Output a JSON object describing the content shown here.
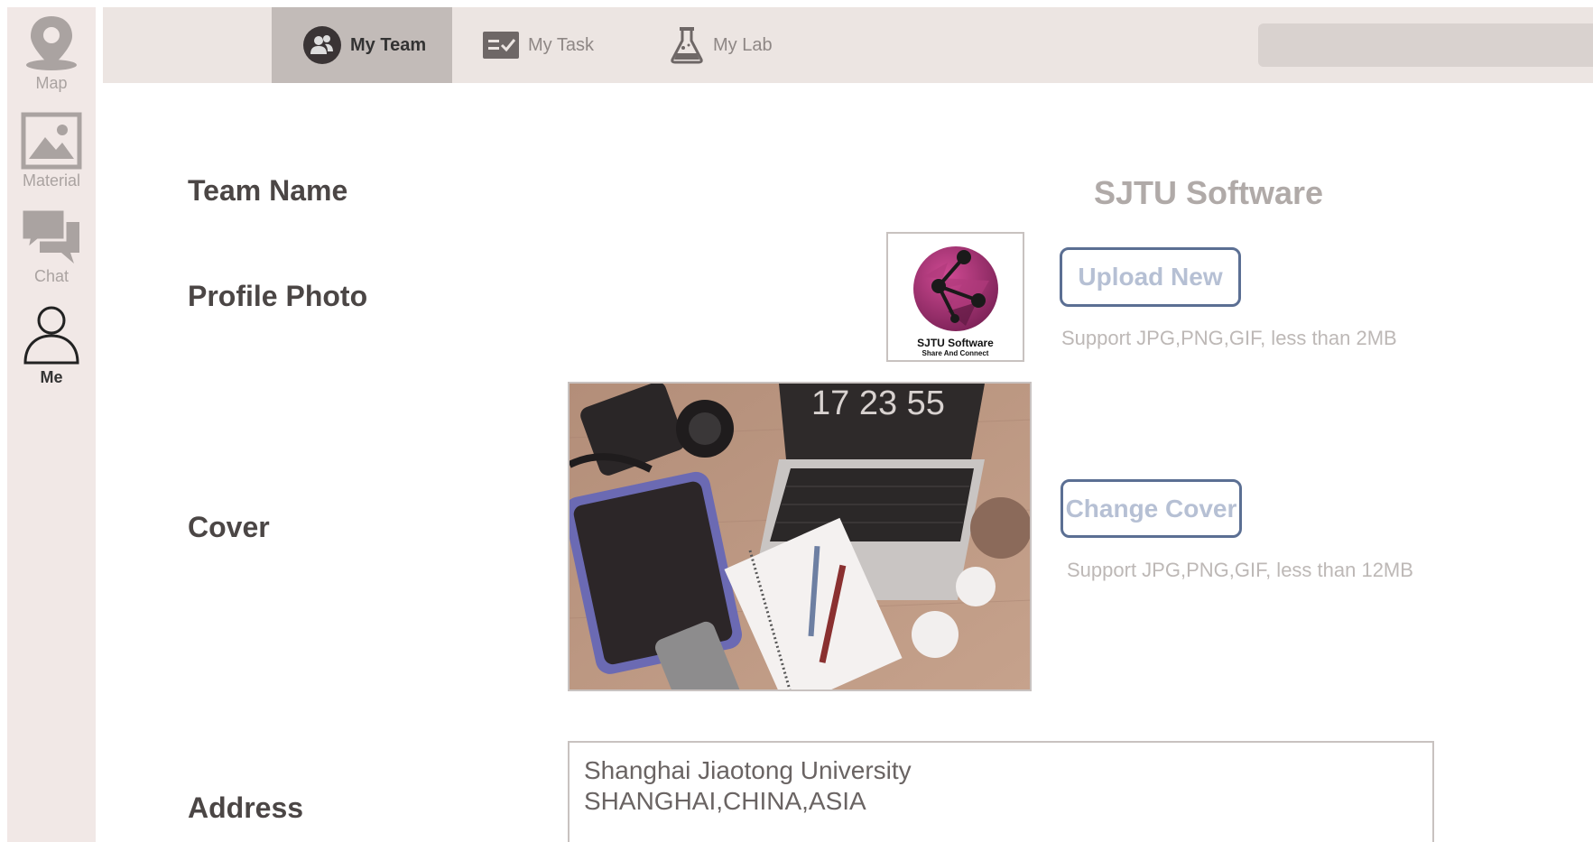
{
  "sidebar": {
    "items": [
      {
        "label": "Map",
        "icon": "map-pin-icon"
      },
      {
        "label": "Material",
        "icon": "image-icon"
      },
      {
        "label": "Chat",
        "icon": "chat-bubbles-icon"
      },
      {
        "label": "Me",
        "icon": "user-icon",
        "active": true
      }
    ]
  },
  "topnav": {
    "tabs": [
      {
        "label": "My Team",
        "icon": "team-icon",
        "active": true
      },
      {
        "label": "My Task",
        "icon": "task-icon"
      },
      {
        "label": "My Lab",
        "icon": "flask-icon"
      }
    ],
    "search": {
      "value": "",
      "placeholder": ""
    }
  },
  "form": {
    "team_name_label": "Team Name",
    "team_name_value": "SJTU Software",
    "profile_label": "Profile Photo",
    "profile_logo_title": "SJTU Software",
    "profile_logo_subtitle": "Share And Connect",
    "upload_button": "Upload New",
    "upload_hint": "Support JPG,PNG,GIF, less than 2MB",
    "cover_label": "Cover",
    "cover_clock_text": "17 23 55",
    "change_cover_button": "Change Cover",
    "cover_hint": "Support JPG,PNG,GIF, less than 12MB",
    "address_label": "Address",
    "address_line1": "Shanghai Jiaotong University",
    "address_line2": "SHANGHAI,CHINA,ASIA"
  },
  "colors": {
    "rail_bg": "#f1e8e6",
    "topnav_bg": "#ece5e2",
    "active_tab_bg": "#c2bbb8",
    "button_border": "#5b6f93",
    "button_text": "#b6c0d4",
    "logo_purple": "#a0346f"
  }
}
